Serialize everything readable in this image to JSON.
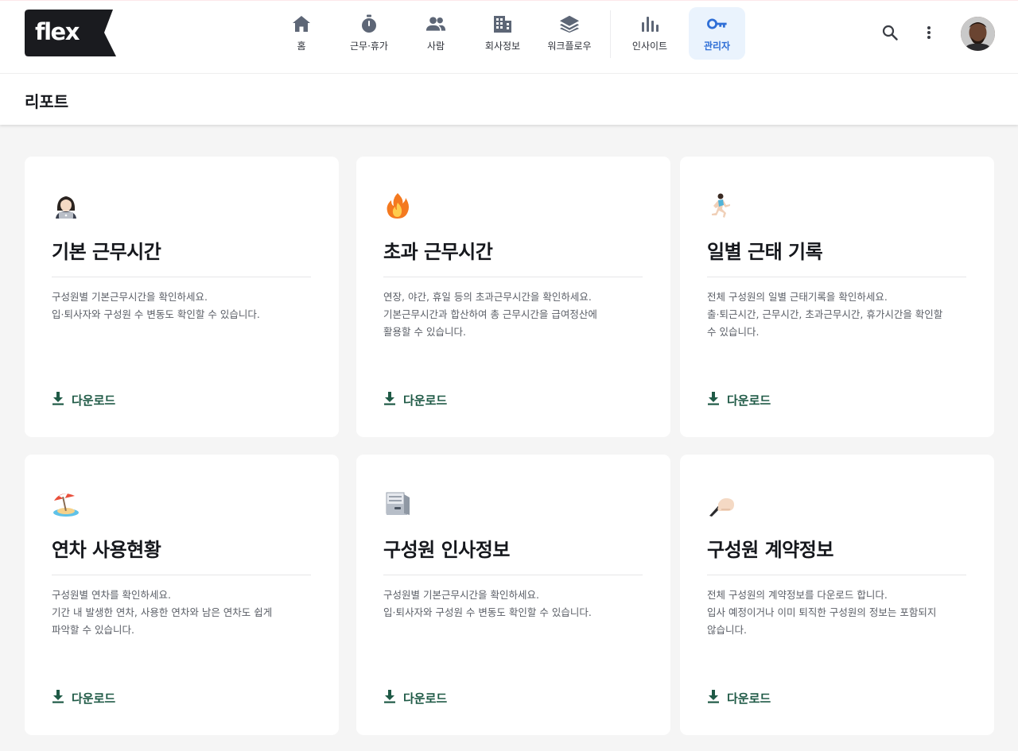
{
  "brand": {
    "logo_text": "flex"
  },
  "nav": [
    {
      "label": "홈",
      "icon": "home-icon"
    },
    {
      "label": "근무·휴가",
      "icon": "stopwatch-icon"
    },
    {
      "label": "사람",
      "icon": "people-icon"
    },
    {
      "label": "회사정보",
      "icon": "building-icon"
    },
    {
      "label": "워크플로우",
      "icon": "layers-icon"
    },
    {
      "label": "인사이트",
      "icon": "bar-chart-icon"
    },
    {
      "label": "관리자",
      "icon": "key-icon",
      "active": true
    }
  ],
  "actions": {
    "search_icon": "search-icon",
    "more_icon": "more-vertical-icon"
  },
  "page": {
    "title": "리포트"
  },
  "colors": {
    "accent": "#2f6fd6",
    "download": "#1f5a46",
    "background": "#f5f5f5"
  },
  "cards": [
    {
      "emoji": "woman-technologist-emoji",
      "title": "기본 근무시간",
      "desc": [
        "구성원별 기본근무시간을 확인하세요.",
        "입·퇴사자와 구성원 수 변동도 확인할 수 있습니다."
      ],
      "download": "다운로드"
    },
    {
      "emoji": "fire-emoji",
      "title": "초과 근무시간",
      "desc": [
        "연장, 야간, 휴일 등의 초과근무시간을 확인하세요.",
        "기본근무시간과 합산하여 총 근무시간을 급여정산에",
        "활용할 수 있습니다."
      ],
      "download": "다운로드"
    },
    {
      "emoji": "runner-emoji",
      "title": "일별 근태 기록",
      "desc": [
        "전체 구성원의 일별 근태기록을 확인하세요.",
        "출·퇴근시간, 근무시간, 초과근무시간, 휴가시간을 확인할",
        "수 있습니다."
      ],
      "download": "다운로드"
    },
    {
      "emoji": "beach-umbrella-emoji",
      "title": "연차 사용현황",
      "desc": [
        "구성원별 연차를 확인하세요.",
        "기간 내 발생한 연차, 사용한 연차와 남은 연차도 쉽게",
        "파악할 수 있습니다."
      ],
      "download": "다운로드"
    },
    {
      "emoji": "card-file-box-emoji",
      "title": "구성원 인사정보",
      "desc": [
        "구성원별 기본근무시간을 확인하세요.",
        "입·퇴사자와 구성원 수 변동도 확인할 수 있습니다."
      ],
      "download": "다운로드"
    },
    {
      "emoji": "writing-hand-emoji",
      "title": "구성원 계약정보",
      "desc": [
        "전체 구성원의 계약정보를 다운로드 합니다.",
        "입사 예정이거나 이미 퇴직한 구성원의 정보는 포함되지",
        "않습니다."
      ],
      "download": "다운로드"
    }
  ]
}
